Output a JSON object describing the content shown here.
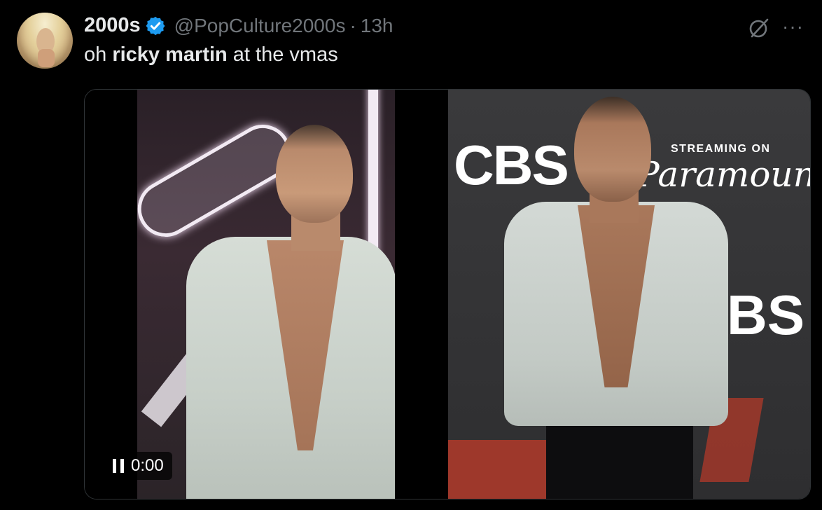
{
  "tweet": {
    "author_name": "2000s",
    "handle": "@PopCulture2000s",
    "separator": "·",
    "time": "13h",
    "text_prefix": "oh ",
    "text_bold": "ricky martin",
    "text_suffix": " at the vmas",
    "more_label": "···"
  },
  "media": {
    "left_video_time": "0:00",
    "right_photo": {
      "brand_cbs": "CBS",
      "streaming_on": "STREAMING ON",
      "paramount": "Paramount+",
      "bs": "BS"
    }
  },
  "icons": {
    "verified": "verified-badge-icon",
    "grok": "grok-icon",
    "more": "more-icon",
    "pause": "pause-icon"
  },
  "colors": {
    "background": "#000000",
    "text_primary": "#e7e9ea",
    "text_secondary": "#71767b",
    "verified_blue": "#1d9bf0",
    "border": "#2f3336"
  }
}
